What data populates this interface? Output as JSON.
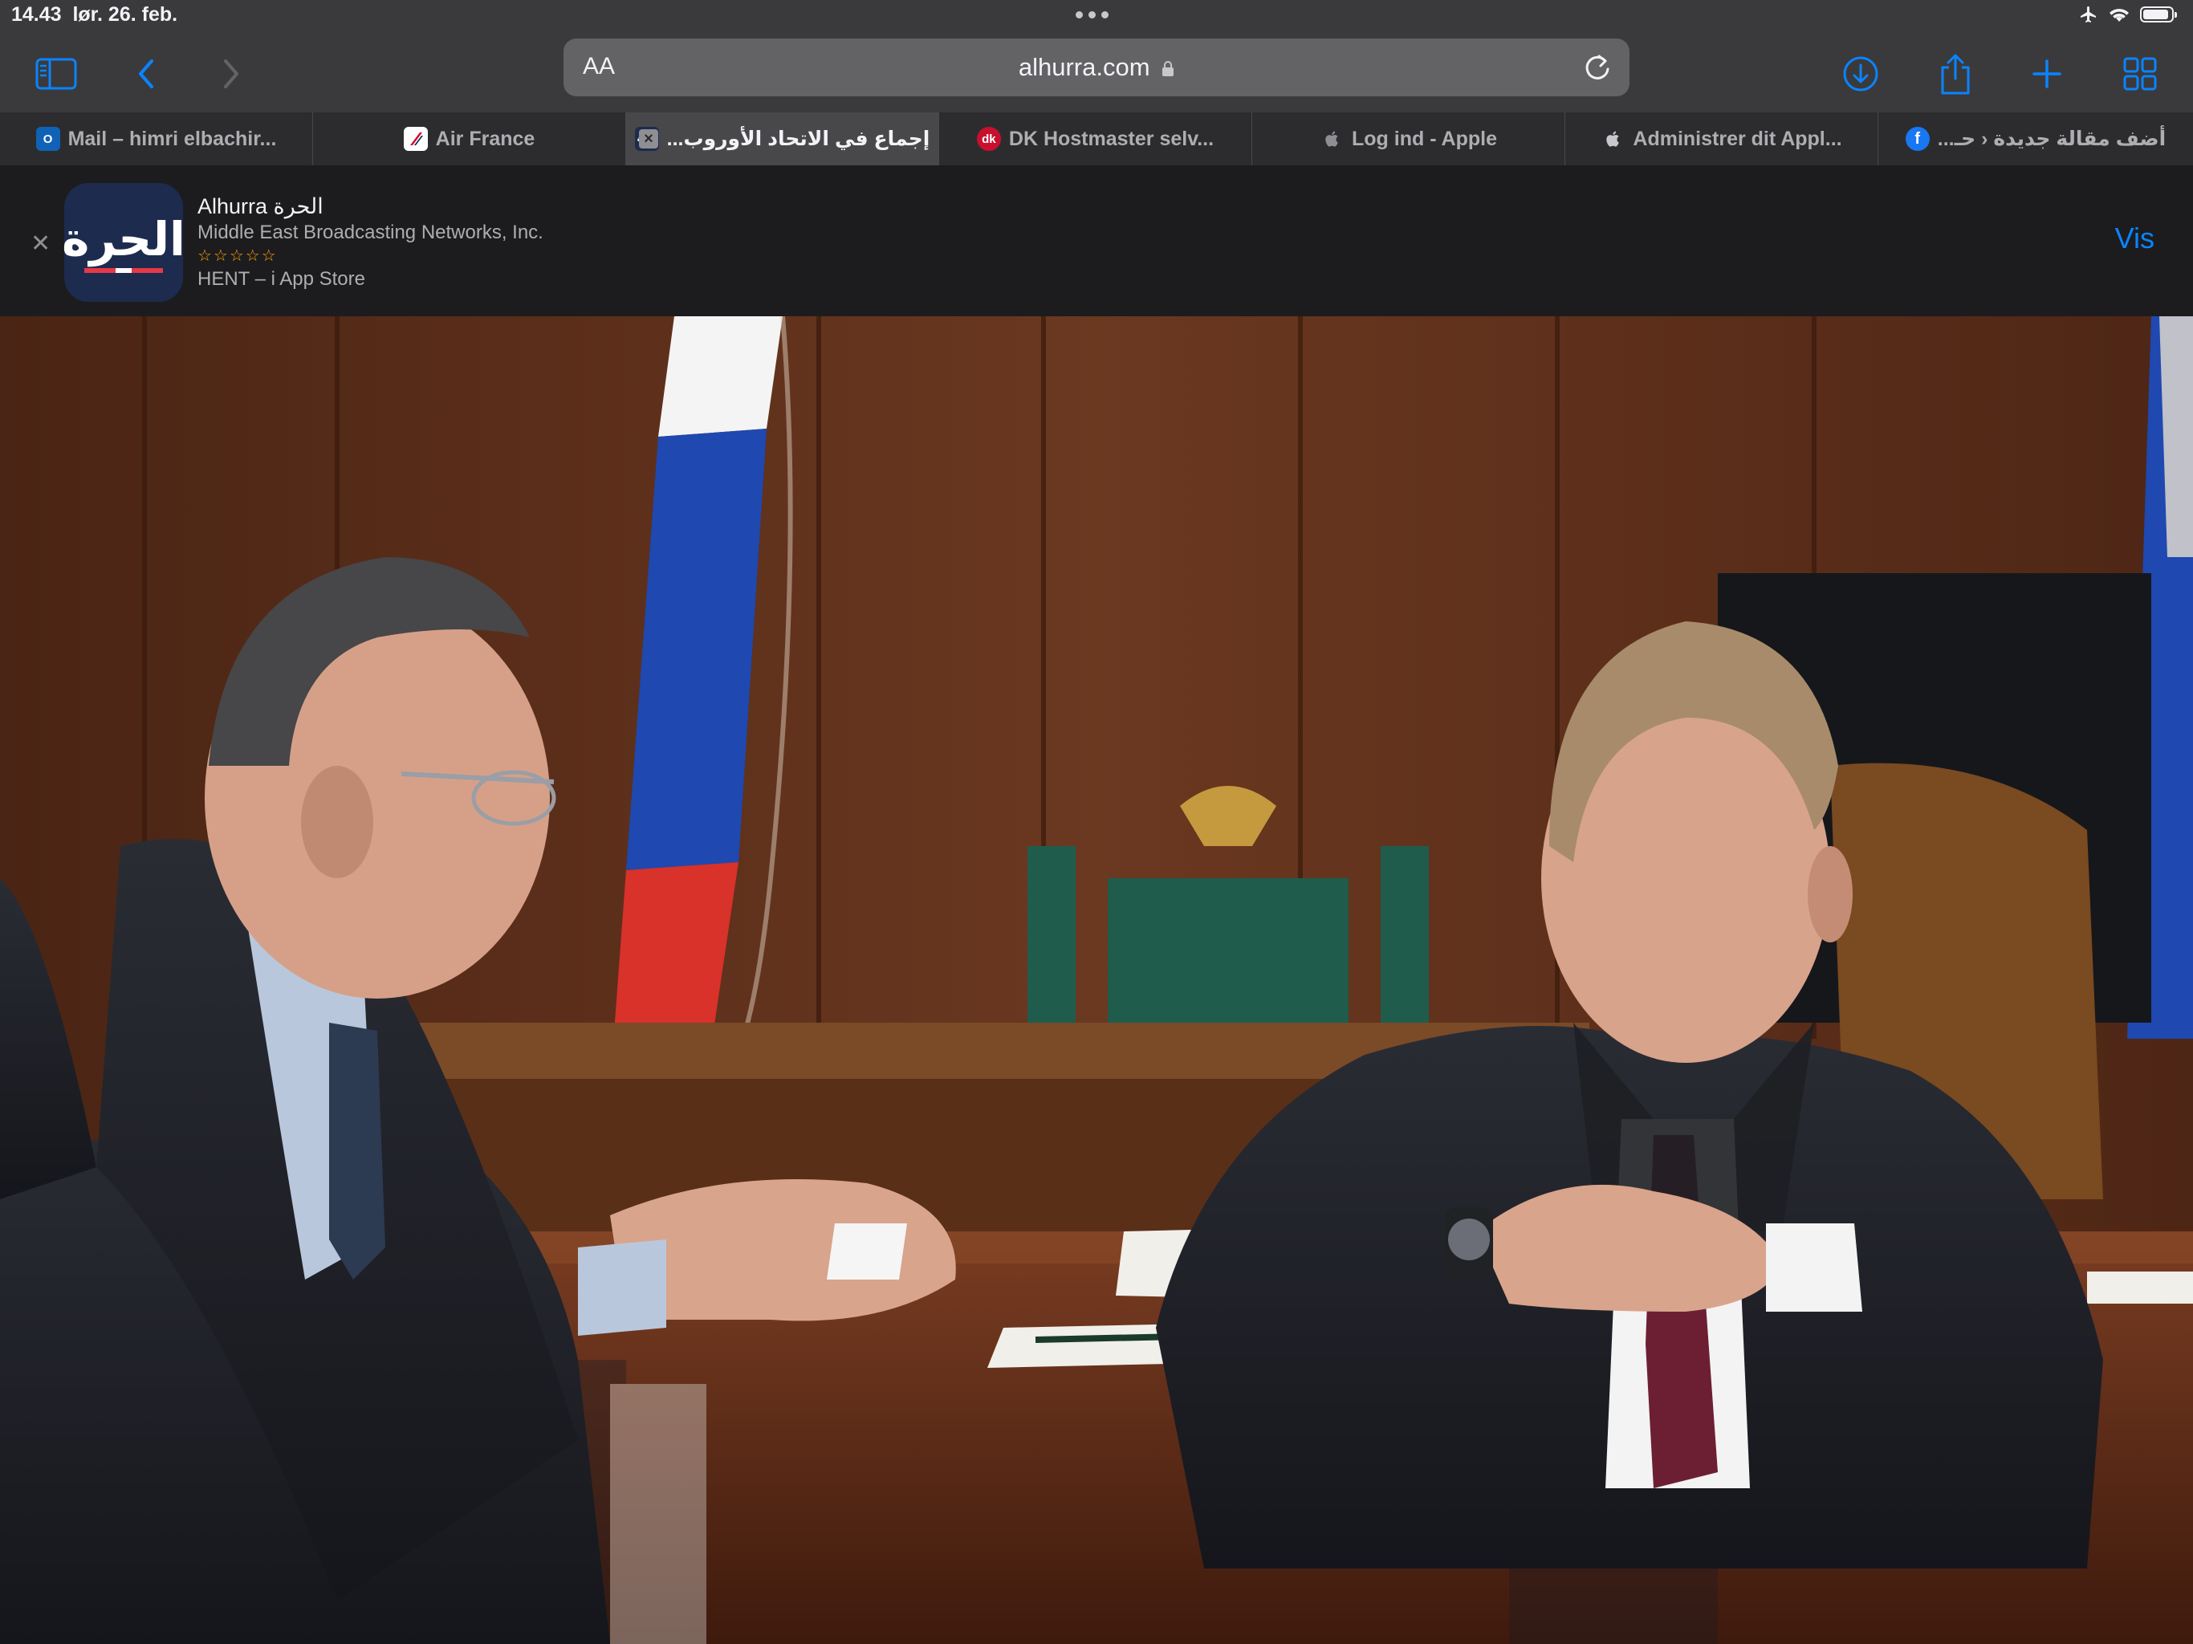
{
  "status": {
    "time": "14.43",
    "date": "lør. 26. feb."
  },
  "toolbar": {
    "reader_label": "AA",
    "url": "alhurra.com"
  },
  "tabs": [
    {
      "label": "Mail – himri elbachir...",
      "favicon": "outlook-icon",
      "favicon_text": "O"
    },
    {
      "label": "Air France",
      "favicon": "airfrance-icon",
      "favicon_text": ""
    },
    {
      "label": "إجماع في الاتحاد الأوروب...",
      "favicon": "alhurra-icon",
      "favicon_text": "الحرة",
      "active": true
    },
    {
      "label": "DK Hostmaster selv...",
      "favicon": "dk-icon",
      "favicon_text": "dk"
    },
    {
      "label": "Log ind - Apple",
      "favicon": "apple-icon",
      "favicon_text": ""
    },
    {
      "label": "Administrer dit Appl...",
      "favicon": "apple-icon",
      "favicon_text": ""
    },
    {
      "label": "أضف مقالة جديدة ‹ حـ...",
      "favicon": "facebook-icon",
      "favicon_text": "f"
    }
  ],
  "banner": {
    "app_name": "Alhurra الحرة",
    "developer": "Middle East Broadcasting Networks, Inc.",
    "stars": "☆☆☆☆☆",
    "get_text": "HENT – i App Store",
    "view_label": "Vis",
    "icon_text": "الحرة"
  },
  "colors": {
    "accent": "#0a84ff",
    "toolbar_bg": "#3a3a3c",
    "tabbar_bg": "#2c2c2e",
    "banner_bg": "#1c1c1e"
  }
}
